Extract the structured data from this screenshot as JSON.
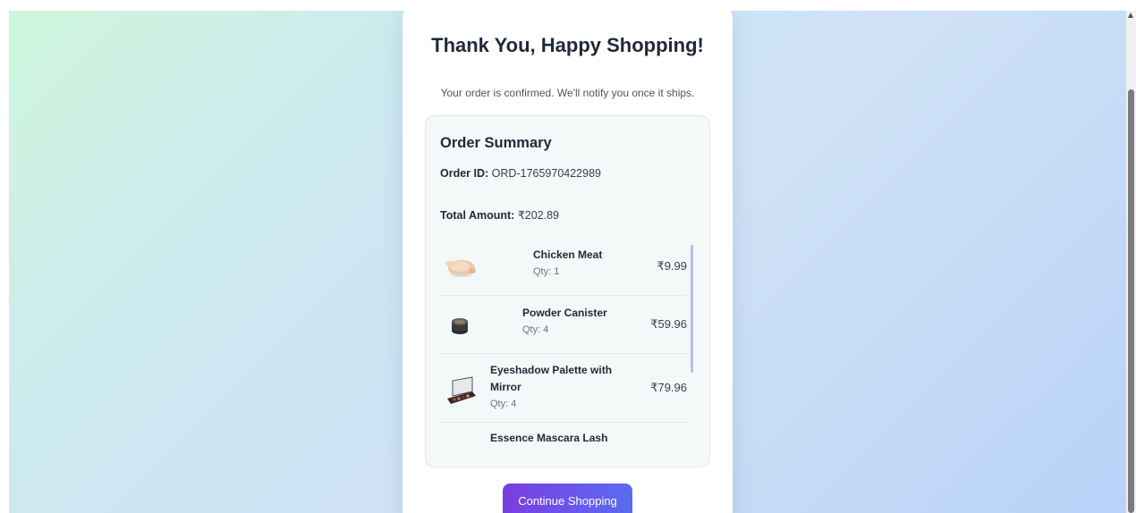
{
  "header": {
    "title": "Thank You, Happy Shopping!",
    "subtitle": "Your order is confirmed. We'll notify you once it ships."
  },
  "summary": {
    "title": "Order Summary",
    "order_id_label": "Order ID:",
    "order_id": "ORD-1765970422989",
    "total_label": "Total Amount:",
    "total": "₹202.89"
  },
  "items": [
    {
      "name": "Chicken Meat",
      "qty": "Qty: 1",
      "price": "₹9.99",
      "icon": "chicken-meat-icon"
    },
    {
      "name": "Powder Canister",
      "qty": "Qty: 4",
      "price": "₹59.96",
      "icon": "powder-canister-icon"
    },
    {
      "name": "Eyeshadow Palette with Mirror",
      "qty": "Qty: 4",
      "price": "₹79.96",
      "icon": "eyeshadow-palette-icon"
    },
    {
      "name": "Essence Mascara Lash",
      "qty": "",
      "price": "",
      "icon": "mascara-icon"
    }
  ],
  "actions": {
    "continue_label": "Continue Shopping"
  },
  "colors": {
    "accent_start": "#7a3de0",
    "accent_end": "#5b6cf0",
    "scroll_accent": "#c9b4f5"
  }
}
